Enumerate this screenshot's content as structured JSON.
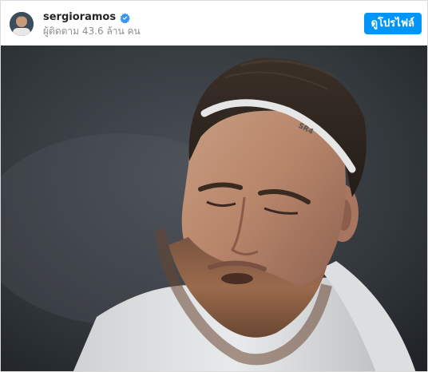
{
  "post": {
    "username": "sergioramos",
    "followers_text": "ผู้ติดตาม 43.6 ล้าน คน",
    "view_profile_label": "ดูโปรไฟล์",
    "verified_icon": "verified-badge-icon",
    "headband_text": "SR4"
  },
  "colors": {
    "accent": "#0095f6",
    "username": "#262626",
    "secondary_text": "#8e8e8e",
    "border": "#dbdbdb"
  }
}
